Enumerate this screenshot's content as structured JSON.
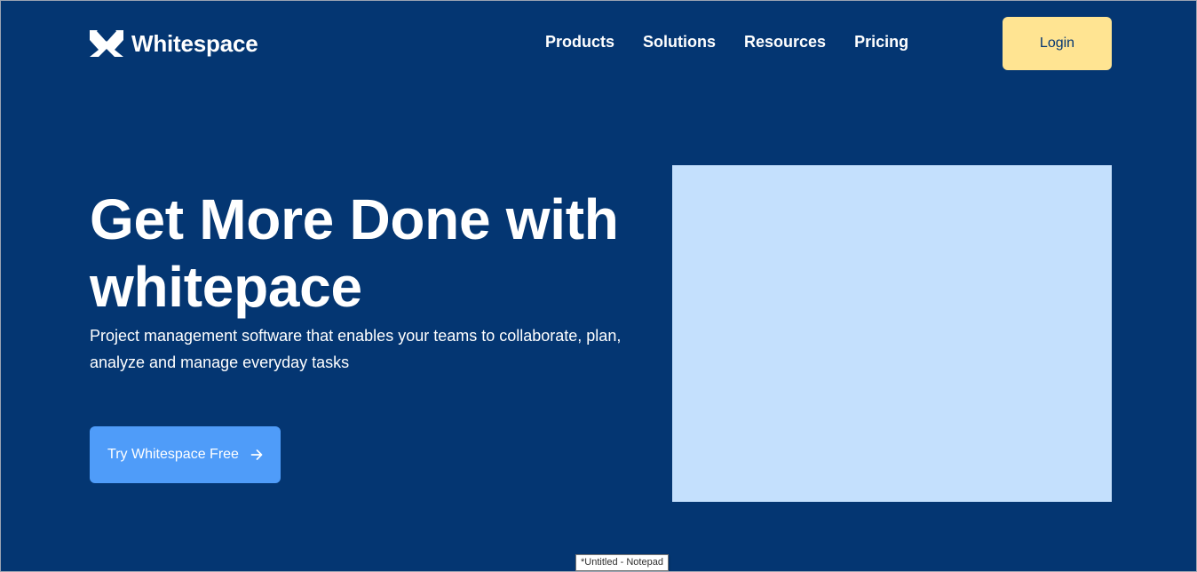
{
  "brand": {
    "name": "Whitespace",
    "background_color": "#043672",
    "accent_color": "#4f9cf9",
    "login_color": "#ffe492",
    "image_placeholder_color": "#c4e0fd"
  },
  "header": {
    "nav_items": [
      "Products",
      "Solutions",
      "Resources",
      "Pricing"
    ],
    "login_label": "Login"
  },
  "hero": {
    "title": "Get More Done with whitepace",
    "subtitle": "Project management software that enables your teams to collaborate, plan, analyze and manage everyday tasks",
    "cta_label": "Try Whitespace Free",
    "cta_icon": "arrow-right-icon"
  },
  "tooltip": {
    "text": "*Untitled - Notepad"
  }
}
